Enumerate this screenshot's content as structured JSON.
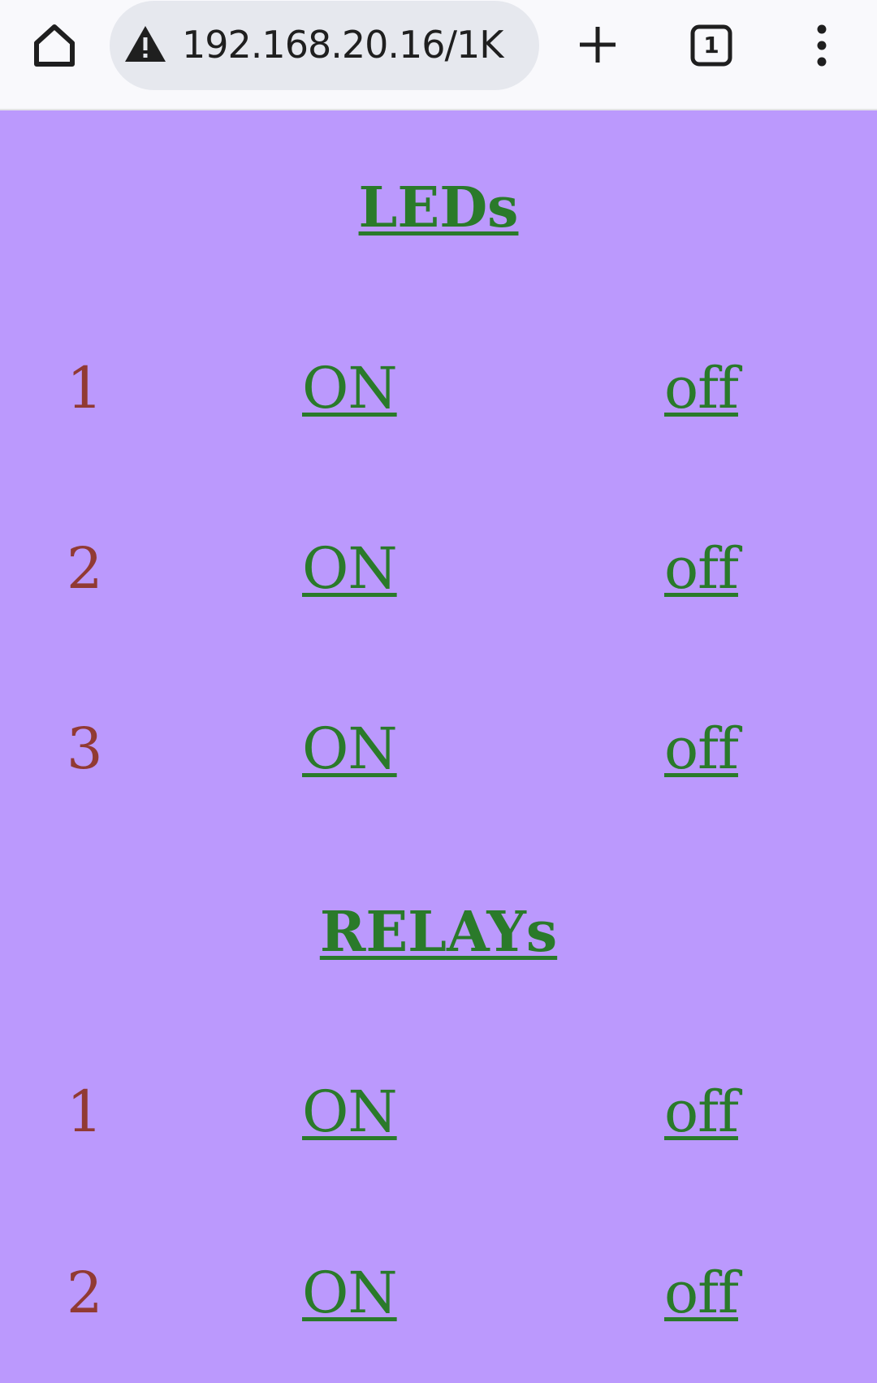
{
  "browser": {
    "url": "192.168.20.16/1K",
    "tab_count": "1",
    "icons": {
      "home": "home-icon",
      "warning": "warning-icon",
      "new_tab": "plus-icon",
      "tabs": "tab-switcher-icon",
      "menu": "more-vert-icon"
    }
  },
  "leds": {
    "title": "LEDs",
    "rows": [
      {
        "number": "1",
        "on_label": "ON",
        "off_label": "off"
      },
      {
        "number": "2",
        "on_label": "ON",
        "off_label": "off"
      },
      {
        "number": "3",
        "on_label": "ON",
        "off_label": "off"
      }
    ]
  },
  "relays": {
    "title": "RELAYs",
    "rows": [
      {
        "number": "1",
        "on_label": "ON",
        "off_label": "off"
      },
      {
        "number": "2",
        "on_label": "ON",
        "off_label": "off"
      }
    ]
  },
  "colors": {
    "page_background": "#bb99fd",
    "link_green": "#2a7a2a",
    "number_red": "#913a33",
    "toolbar_background": "#f9f9fc",
    "urlbar_background": "#e6e8ee"
  }
}
